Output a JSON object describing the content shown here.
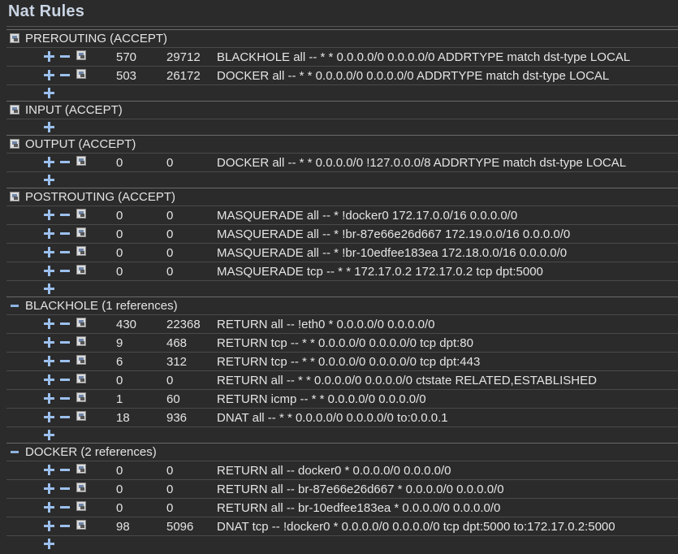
{
  "page_title": "Nat Rules",
  "chains": [
    {
      "label": "PREROUTING (ACCEPT)",
      "header_icon": "edit-chain-icon",
      "rules": [
        {
          "pkts": "570",
          "bytes": "29712",
          "text": "BLACKHOLE all -- * * 0.0.0.0/0 0.0.0.0/0 ADDRTYPE match dst-type LOCAL"
        },
        {
          "pkts": "503",
          "bytes": "26172",
          "text": "DOCKER all -- * * 0.0.0.0/0 0.0.0.0/0 ADDRTYPE match dst-type LOCAL"
        }
      ]
    },
    {
      "label": "INPUT (ACCEPT)",
      "header_icon": "edit-chain-icon",
      "rules": []
    },
    {
      "label": "OUTPUT (ACCEPT)",
      "header_icon": "edit-chain-icon",
      "rules": [
        {
          "pkts": "0",
          "bytes": "0",
          "text": "DOCKER all -- * * 0.0.0.0/0 !127.0.0.0/8 ADDRTYPE match dst-type LOCAL"
        }
      ]
    },
    {
      "label": "POSTROUTING (ACCEPT)",
      "header_icon": "edit-chain-icon",
      "rules": [
        {
          "pkts": "0",
          "bytes": "0",
          "text": "MASQUERADE all -- * !docker0 172.17.0.0/16 0.0.0.0/0"
        },
        {
          "pkts": "0",
          "bytes": "0",
          "text": "MASQUERADE all -- * !br-87e66e26d667 172.19.0.0/16 0.0.0.0/0"
        },
        {
          "pkts": "0",
          "bytes": "0",
          "text": "MASQUERADE all -- * !br-10edfee183ea 172.18.0.0/16 0.0.0.0/0"
        },
        {
          "pkts": "0",
          "bytes": "0",
          "text": "MASQUERADE tcp -- * * 172.17.0.2 172.17.0.2 tcp dpt:5000"
        }
      ]
    },
    {
      "label": "BLACKHOLE (1 references)",
      "header_icon": "collapse-chain-icon",
      "rules": [
        {
          "pkts": "430",
          "bytes": "22368",
          "text": "RETURN all -- !eth0 * 0.0.0.0/0 0.0.0.0/0"
        },
        {
          "pkts": "9",
          "bytes": "468",
          "text": "RETURN tcp -- * * 0.0.0.0/0 0.0.0.0/0 tcp dpt:80"
        },
        {
          "pkts": "6",
          "bytes": "312",
          "text": "RETURN tcp -- * * 0.0.0.0/0 0.0.0.0/0 tcp dpt:443"
        },
        {
          "pkts": "0",
          "bytes": "0",
          "text": "RETURN all -- * * 0.0.0.0/0 0.0.0.0/0 ctstate RELATED,ESTABLISHED"
        },
        {
          "pkts": "1",
          "bytes": "60",
          "text": "RETURN icmp -- * * 0.0.0.0/0 0.0.0.0/0"
        },
        {
          "pkts": "18",
          "bytes": "936",
          "text": "DNAT all -- * * 0.0.0.0/0 0.0.0.0/0 to:0.0.0.1"
        }
      ]
    },
    {
      "label": "DOCKER (2 references)",
      "header_icon": "collapse-chain-icon",
      "rules": [
        {
          "pkts": "0",
          "bytes": "0",
          "text": "RETURN all -- docker0 * 0.0.0.0/0 0.0.0.0/0"
        },
        {
          "pkts": "0",
          "bytes": "0",
          "text": "RETURN all -- br-87e66e26d667 * 0.0.0.0/0 0.0.0.0/0"
        },
        {
          "pkts": "0",
          "bytes": "0",
          "text": "RETURN all -- br-10edfee183ea * 0.0.0.0/0 0.0.0.0/0"
        },
        {
          "pkts": "98",
          "bytes": "5096",
          "text": "DNAT tcp -- !docker0 * 0.0.0.0/0 0.0.0.0/0 tcp dpt:5000 to:172.17.0.2:5000"
        }
      ]
    }
  ]
}
